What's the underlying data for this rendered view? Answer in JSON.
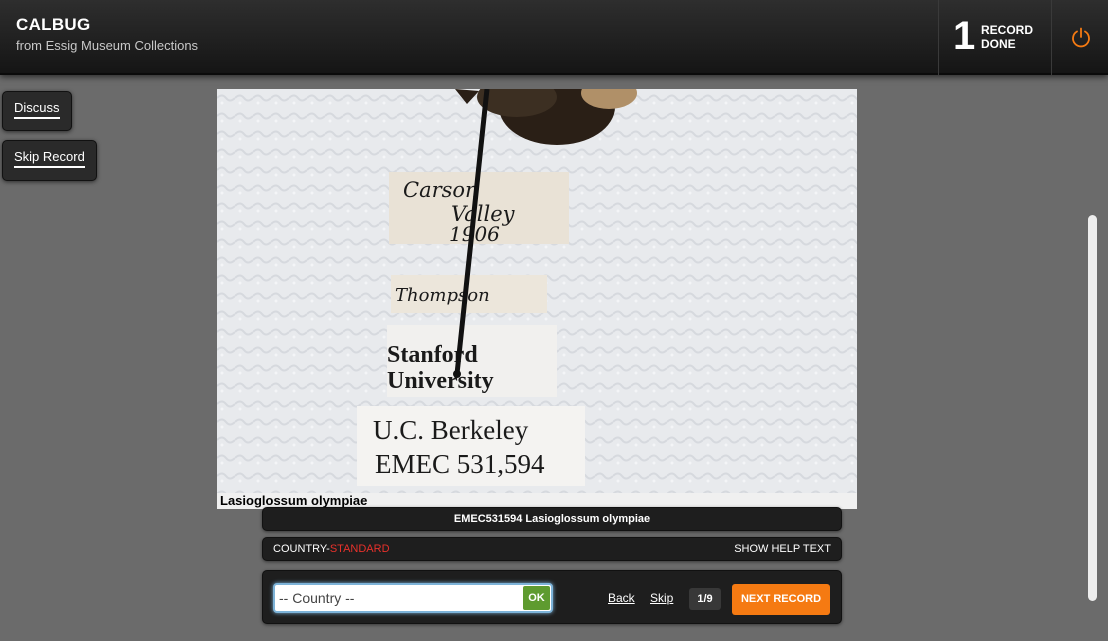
{
  "header": {
    "title": "CALBUG",
    "subtitle": "from Essig Museum Collections",
    "records_count": "1",
    "records_label": "RECORD DONE",
    "power_icon": "power-icon",
    "accent_color": "#f57a12"
  },
  "sidebar": {
    "discuss_label": "Discuss",
    "skip_record_label": "Skip Record"
  },
  "specimen": {
    "labels": [
      "Carson",
      "Valley",
      "1906",
      "Thompson",
      "Stanford",
      "University",
      "U.C. Berkeley",
      "EMEC 531,594"
    ],
    "caption": "Lasioglossum olympiae"
  },
  "record": {
    "title": "EMEC531594 Lasioglossum olympiae"
  },
  "field": {
    "name": "COUNTRY-",
    "type": "STANDARD",
    "help_label": "SHOW HELP TEXT"
  },
  "entry": {
    "country_value": "-- Country --",
    "ok_label": "OK",
    "back_label": "Back",
    "skip_label": "Skip",
    "progress": "1/9",
    "next_label": "NEXT RECORD"
  }
}
